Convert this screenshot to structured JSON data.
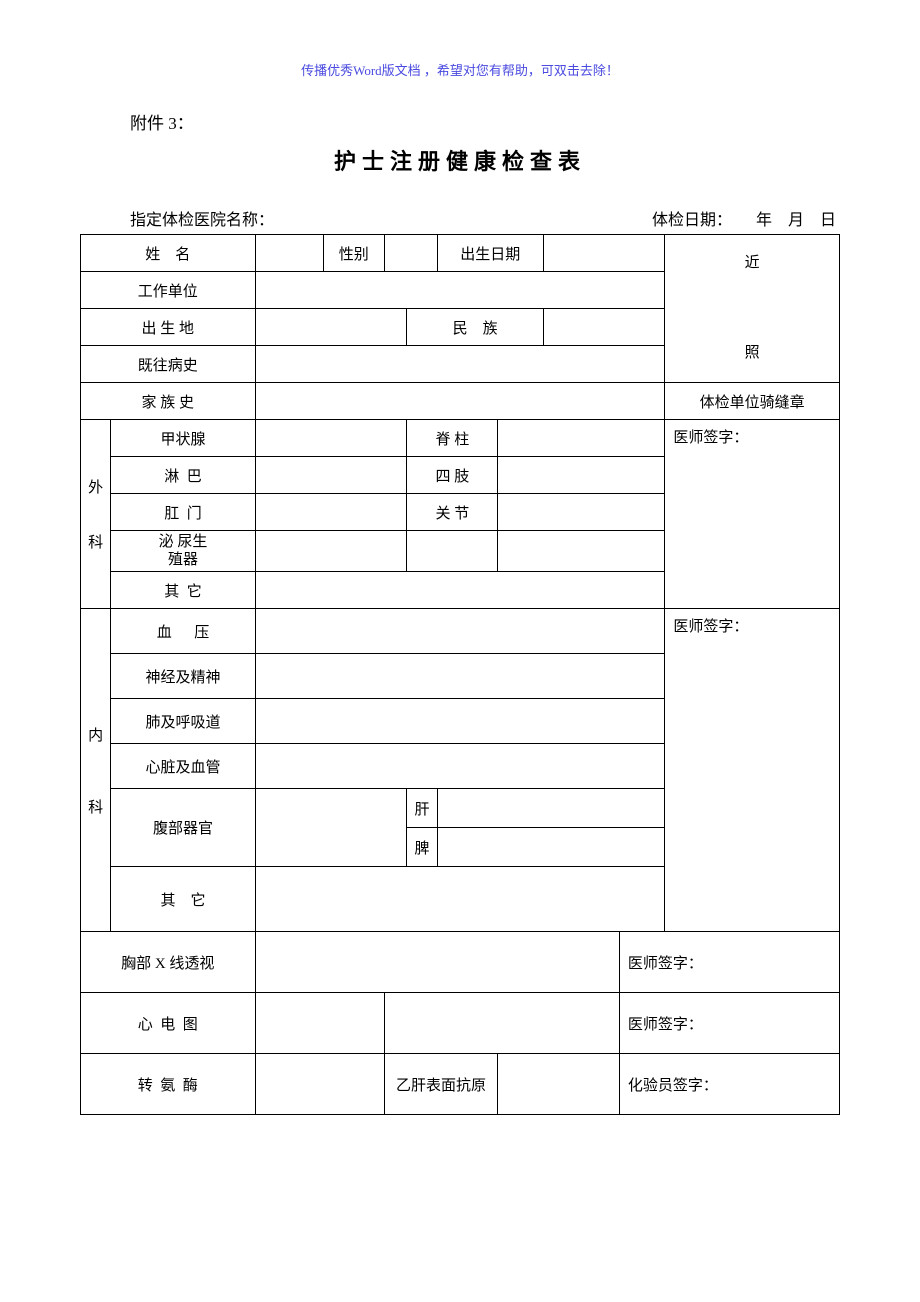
{
  "watermark": "传播优秀Word版文档 ，希望对您有帮助，可双击去除！",
  "attachment": "附件 3：",
  "title": "护士注册健康检查表",
  "header": {
    "hospital_label": "指定体检医院名称：",
    "date_label": "体检日期：",
    "year_unit": "年",
    "month_unit": "月",
    "day_unit": "日"
  },
  "rows": {
    "name": "姓    名",
    "gender": "性别",
    "birth": "出生日期",
    "work_unit": "工作单位",
    "birth_place": "出 生 地",
    "ethnic": "民    族",
    "past_history": "既往病史",
    "family_history": "家 族 史",
    "photo_near": "近",
    "photo_zhao": "照",
    "photo_stamp": "体检单位骑缝章"
  },
  "surgery": {
    "dept": "外",
    "dept2": "科",
    "thyroid": "甲状腺",
    "lymph": "淋  巴",
    "anus": "肛  门",
    "urogenital1": "泌  尿生",
    "urogenital2": "殖器",
    "other": "其  它",
    "spine": "脊 柱",
    "limbs": "四 肢",
    "joints": "关 节",
    "sign": "医师签字："
  },
  "internal": {
    "dept": "内",
    "dept2": "科",
    "bp": "血      压",
    "nerve": "神经及精神",
    "lung": "肺及呼吸道",
    "heart": "心脏及血管",
    "abdomen": "腹部器官",
    "liver": "肝",
    "spleen": "脾",
    "other": "其    它",
    "sign": "医师签字："
  },
  "chest": {
    "label": "胸部 X 线透视",
    "sign": "医师签字："
  },
  "ecg": {
    "label": "心  电  图",
    "sign": "医师签字："
  },
  "lab": {
    "alt": "转  氨  酶",
    "hbsag": "乙肝表面抗原",
    "sign": "化验员签字："
  }
}
